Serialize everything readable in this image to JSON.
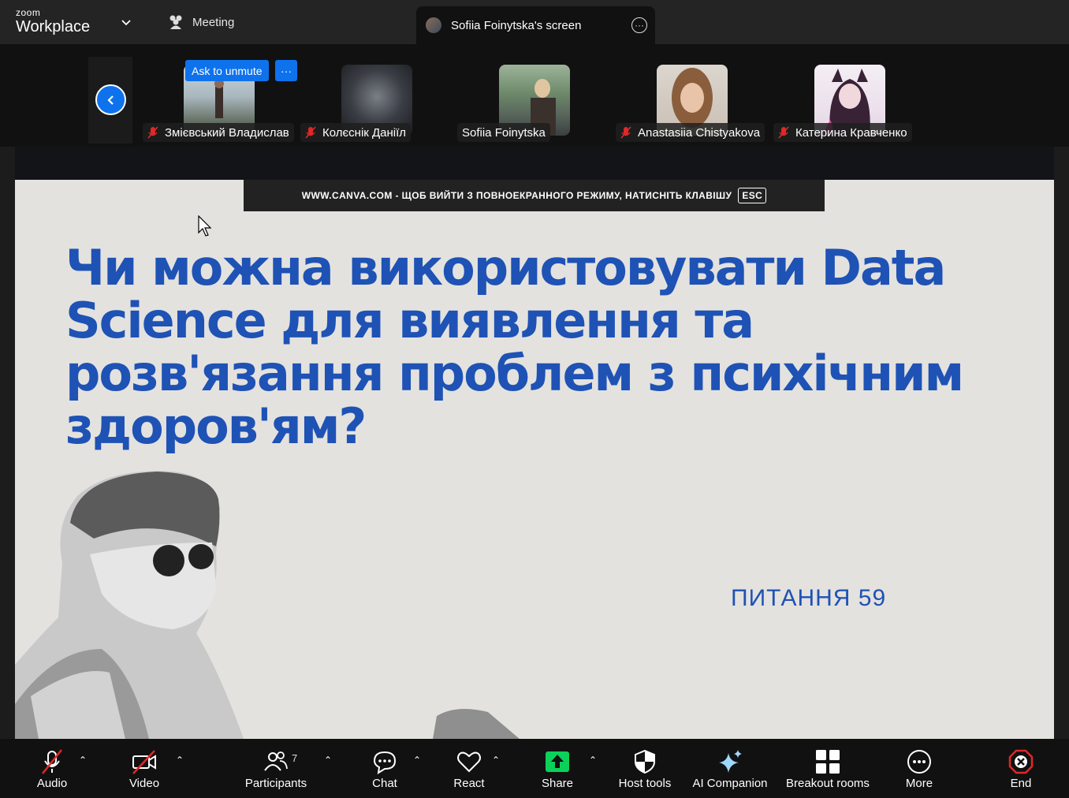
{
  "app": {
    "brand_small": "zoom",
    "brand_big": "Workplace"
  },
  "tabs": {
    "meeting": "Meeting",
    "screen": "Sofiia Foinytska's screen"
  },
  "gallery": {
    "ask_to_unmute": "Ask to unmute",
    "ask_more": "···",
    "participants": [
      {
        "name": "Змієвський Владислав",
        "muted": true
      },
      {
        "name": "Колєснік Даніїл",
        "muted": true
      },
      {
        "name": "Sofiia Foinytska",
        "muted": false
      },
      {
        "name": "Anastasiia Chistyakova",
        "muted": true
      },
      {
        "name": "Катерина Кравченко",
        "muted": true
      }
    ]
  },
  "slide": {
    "banner": "WWW.CANVA.COM - ЩОБ ВИЙТИ З ПОВНОЕКРАННОГО РЕЖИМУ, НАТИСНІТЬ КЛАВІШУ",
    "esc": "ESC",
    "title_lines": [
      "Чи можна використовувати Data",
      "Science для виявлення та",
      "розв'язання проблем з психічним",
      "здоров'ям?"
    ],
    "question_number": "ПИТАННЯ 59"
  },
  "toolbar": {
    "audio": "Audio",
    "video": "Video",
    "participants": "Participants",
    "participants_count": "7",
    "chat": "Chat",
    "react": "React",
    "share": "Share",
    "host_tools": "Host tools",
    "ai_companion": "AI Companion",
    "breakout_rooms": "Breakout rooms",
    "more": "More",
    "end": "End"
  },
  "colors": {
    "accent": "#0e72ed",
    "slide_title": "#1e52b5",
    "share_green": "#0bd15a",
    "end_red": "#e02828",
    "muted_red": "#e02828"
  }
}
